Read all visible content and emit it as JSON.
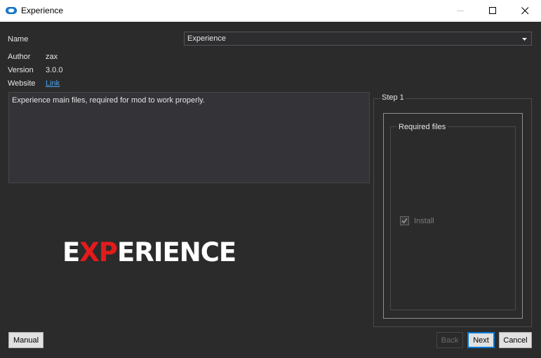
{
  "window": {
    "title": "Experience",
    "app_icon": "cloud-icon",
    "controls": [
      "minimize-icon",
      "maximize-icon",
      "close-icon"
    ]
  },
  "info": {
    "name_label": "Name",
    "name_value": "Experience",
    "author_label": "Author",
    "author_value": "zax",
    "version_label": "Version",
    "version_value": "3.0.0",
    "website_label": "Website",
    "website_link": "Link"
  },
  "description": "Experience main files, required for mod to work properly.",
  "logo": {
    "part1": "E",
    "part2": "XP",
    "part3": "ERIENCE",
    "highlight_color": "#e31b1b"
  },
  "step": {
    "title": "Step 1",
    "group_title": "Required files",
    "option_label": "Install",
    "option_checked": true,
    "option_enabled": false
  },
  "buttons": {
    "manual": "Manual",
    "back": "Back",
    "next": "Next",
    "cancel": "Cancel"
  },
  "colors": {
    "background": "#2b2b2b",
    "link": "#4aa3f0",
    "accent": "#0078d7"
  }
}
